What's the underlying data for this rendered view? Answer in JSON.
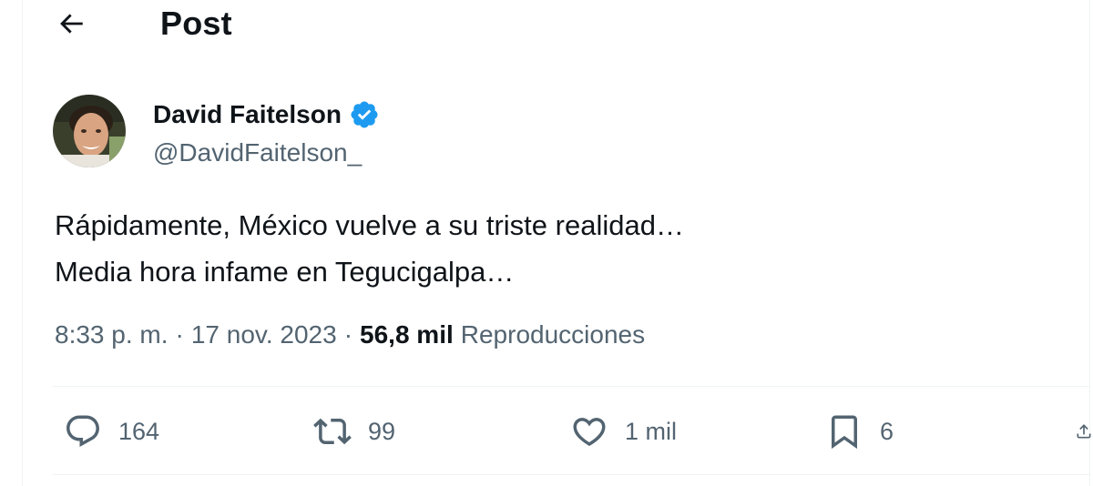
{
  "header": {
    "title": "Post",
    "back_icon": "arrow-left-icon"
  },
  "author": {
    "name": "David Faitelson",
    "handle": "@DavidFaitelson_",
    "verified_icon": "verified-badge-icon",
    "verified_color": "#1d9bf0"
  },
  "post": {
    "lines": [
      "Rápidamente, México vuelve a su triste realidad…",
      "Media hora infame en Tegucigalpa…"
    ],
    "time": "8:33 p. m.",
    "separator": "·",
    "date": "17 nov. 2023",
    "views_count": "56,8 mil",
    "views_label": "Reproducciones"
  },
  "actions": {
    "reply": {
      "icon": "reply-icon",
      "count": "164"
    },
    "retweet": {
      "icon": "retweet-icon",
      "count": "99"
    },
    "like": {
      "icon": "heart-icon",
      "count": "1 mil"
    },
    "bookmark": {
      "icon": "bookmark-icon",
      "count": "6"
    },
    "share": {
      "icon": "share-icon"
    }
  },
  "colors": {
    "text_primary": "#0f1419",
    "text_secondary": "#536471",
    "divider": "#eff3f4",
    "accent": "#1d9bf0"
  }
}
